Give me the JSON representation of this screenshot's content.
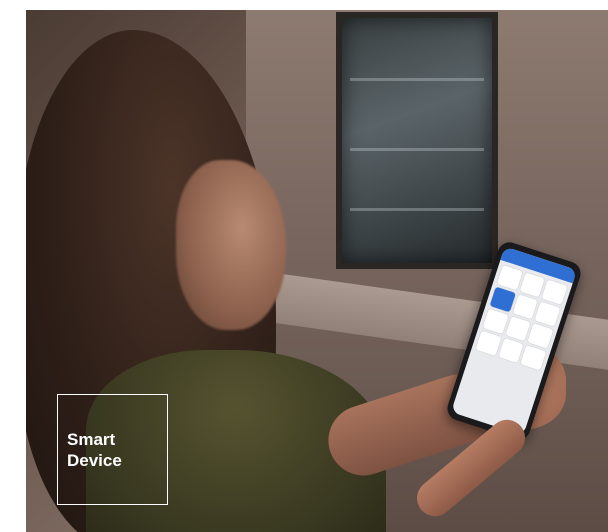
{
  "image": {
    "subject": "photo",
    "label_box": {
      "text": "Smart\nDevice",
      "text_color": "#ffffff",
      "border_color": "#ffffff"
    }
  }
}
